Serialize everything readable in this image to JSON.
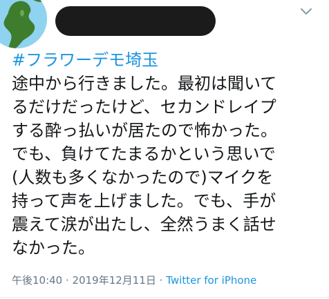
{
  "tweet": {
    "hashtag": "#フラワーデモ埼玉",
    "text_lines": [
      "途中から行きました。最初は聞いて",
      "るだけだったけど、セカンドレイプ",
      "する酔っ払いが居たので怖かった。",
      "でも、負けてたまるかという思いで",
      "(人数も多くなかったので)マイクを",
      "持って声を上げました。でも、手が",
      "震えて涙が出たし、全然うまく話せ",
      "なかった。"
    ],
    "time": "午後10:40",
    "separator1": " · ",
    "date": "2019年12月11日",
    "separator2": " · ",
    "source": "Twitter for iPhone"
  },
  "icons": {
    "avatar": "globe-avatar",
    "menu": "chevron-down-icon"
  },
  "colors": {
    "link": "#1b95e0",
    "text": "#14171a",
    "meta": "#657786",
    "redaction": "#1b1b1b"
  }
}
